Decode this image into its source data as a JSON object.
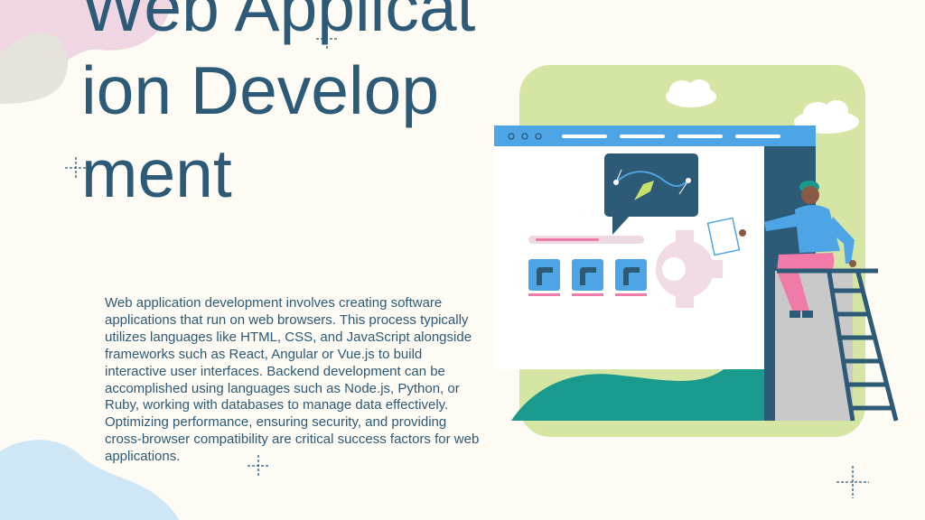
{
  "slide": {
    "title": "Web Application Development",
    "body": "Web application development involves creating software applications that run on web browsers. This process typically utilizes languages like HTML, CSS, and JavaScript alongside frameworks such as React, Angular or Vue.js to build interactive user interfaces. Backend development can be accomplished using languages such as Node.js, Python, or Ruby, working with databases to manage data effectively. Optimizing performance, ensuring security, and providing cross-browser compatibility are critical success factors for web applications."
  },
  "colors": {
    "background": "#fdfbf3",
    "title": "#2d5a76",
    "body_text": "#2d5a76",
    "accent_green": "#d5e6a4",
    "accent_blue": "#4ea5e6",
    "accent_pink": "#f07aa8",
    "teal": "#1a9a8c",
    "navy": "#2d5a76"
  },
  "icons": [
    "browser-window-illustration",
    "chart-bubble-icon",
    "gear-icon",
    "person-sitting-illustration",
    "ladder-illustration",
    "cloud-icon",
    "sparkle-icon"
  ]
}
